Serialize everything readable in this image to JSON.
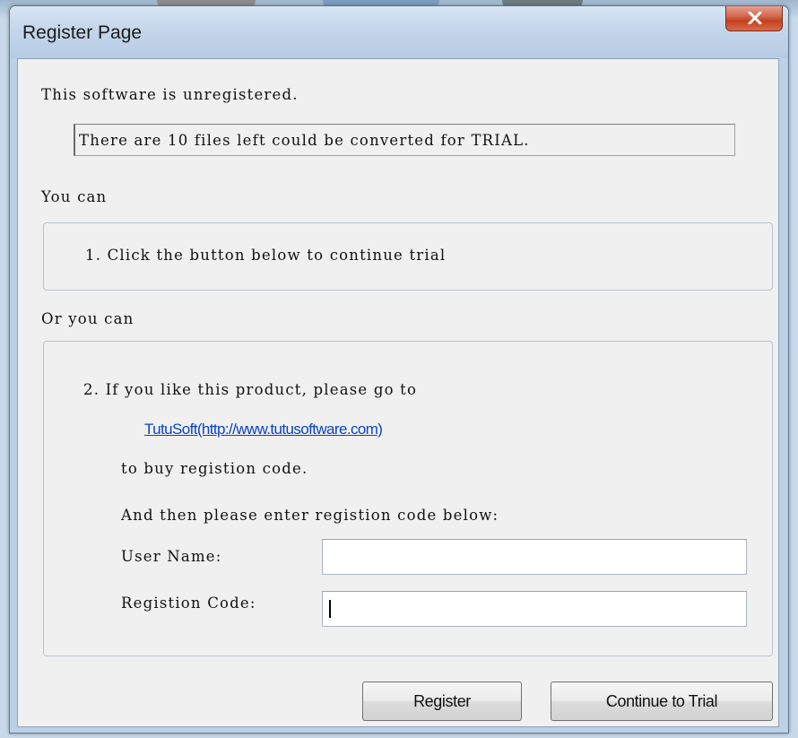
{
  "window": {
    "title": "Register Page"
  },
  "messages": {
    "unregistered": "This software is unregistered.",
    "trial_status": "There are 10 files left could be converted for TRIAL.",
    "you_can": "You can",
    "option1": "1. Click the button below to continue trial",
    "or_you_can": "Or you can",
    "option2": "2. If you like this product, please go to",
    "link_text": "TutuSoft(http://www.tutusoftware.com)",
    "to_buy": "to buy registion code.",
    "enter_below": "And then please enter registion code below:"
  },
  "form": {
    "user_name_label": "User Name:",
    "user_name_value": "",
    "code_label": "Registion Code:",
    "code_value": ""
  },
  "buttons": {
    "register": "Register",
    "continue_trial": "Continue to Trial"
  },
  "colors": {
    "link": "#0a43c5",
    "close_button": "#c2411f",
    "window_frame": "#bcd0e6"
  }
}
